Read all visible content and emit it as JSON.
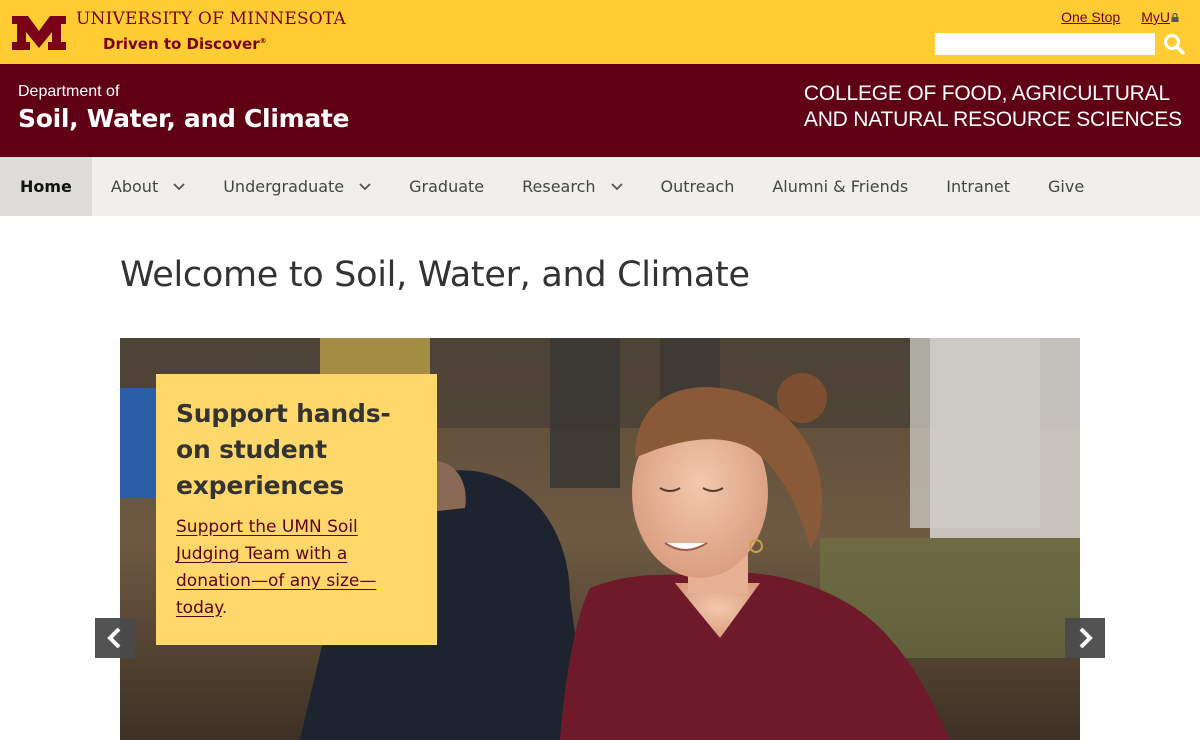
{
  "header": {
    "university_name": "UNIVERSITY OF MINNESOTA",
    "tagline": "Driven to Discover",
    "tagline_mark": "®",
    "util_links": [
      {
        "label": "One Stop"
      },
      {
        "label": "MyU"
      }
    ],
    "search": {
      "placeholder": "",
      "value": ""
    }
  },
  "banner": {
    "dept_prefix": "Department of",
    "dept_name": "Soil, Water, and Climate",
    "college_line1": "COLLEGE OF FOOD, AGRICULTURAL",
    "college_line2": "AND NATURAL RESOURCE SCIENCES"
  },
  "nav": {
    "items": [
      {
        "label": "Home",
        "active": true,
        "dropdown": false
      },
      {
        "label": "About",
        "active": false,
        "dropdown": true
      },
      {
        "label": "Undergraduate",
        "active": false,
        "dropdown": true
      },
      {
        "label": "Graduate",
        "active": false,
        "dropdown": false
      },
      {
        "label": "Research",
        "active": false,
        "dropdown": true
      },
      {
        "label": "Outreach",
        "active": false,
        "dropdown": false
      },
      {
        "label": "Alumni & Friends",
        "active": false,
        "dropdown": false
      },
      {
        "label": "Intranet",
        "active": false,
        "dropdown": false
      },
      {
        "label": "Give",
        "active": false,
        "dropdown": false
      }
    ]
  },
  "main": {
    "title": "Welcome to Soil, Water, and Climate",
    "hero": {
      "callout_title": "Support hands-on student experiences",
      "callout_link": "Support the UMN Soil Judging Team with a donation—of any size—today",
      "callout_tail": "."
    }
  },
  "colors": {
    "gold": "#ffcc33",
    "maroon": "#7a0019",
    "banner_maroon": "#5f0014",
    "nav_bg": "#f0efee",
    "callout_bg": "#ffd86b"
  },
  "icons": {
    "logo": "block-m-logo",
    "search": "search-icon",
    "lock": "lock-icon",
    "dropdown": "chevron-down-icon",
    "prev": "chevron-left-icon",
    "next": "chevron-right-icon"
  }
}
